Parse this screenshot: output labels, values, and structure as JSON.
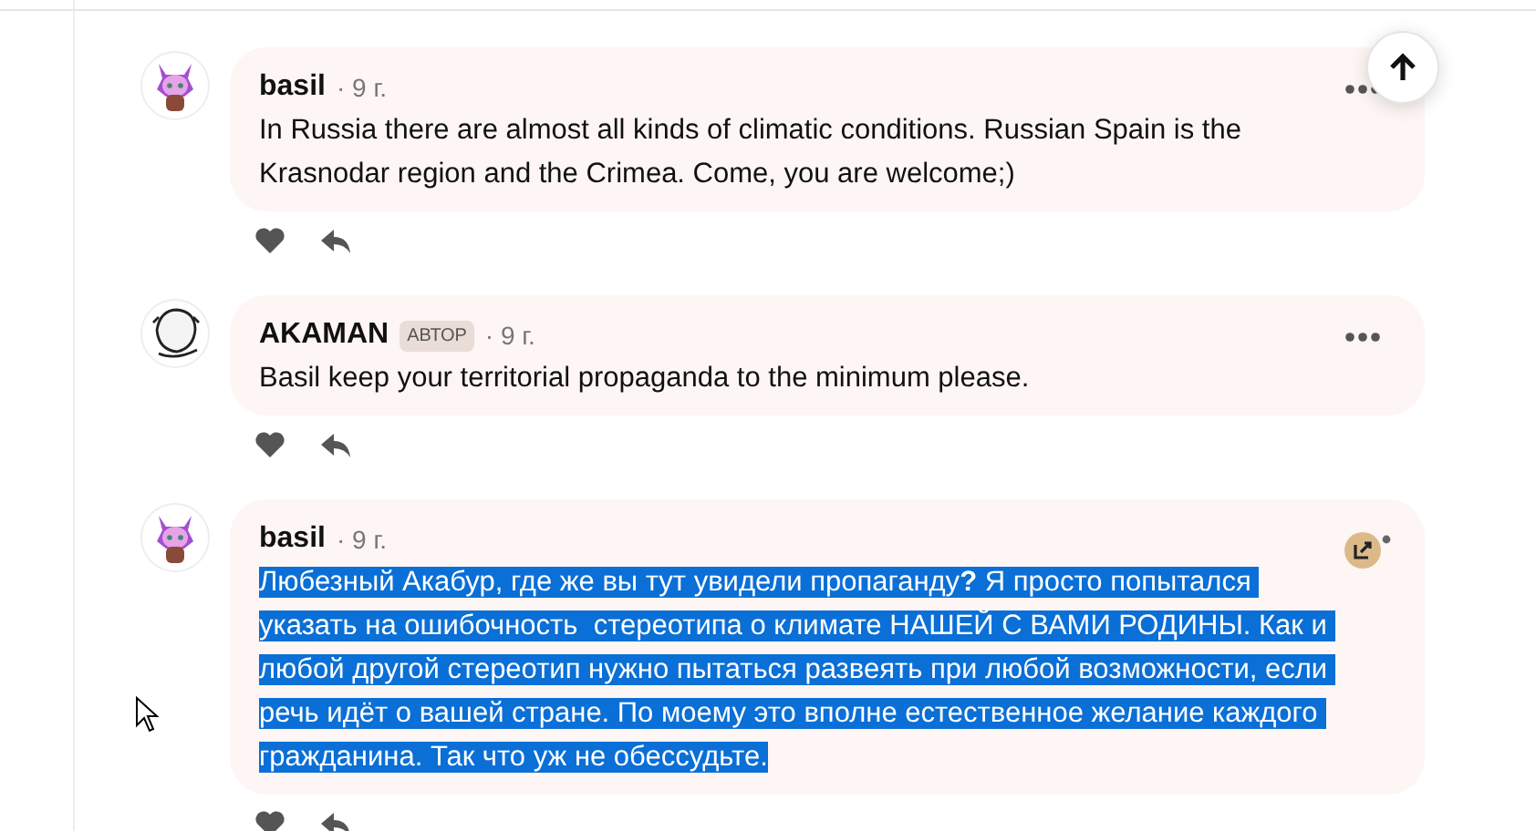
{
  "comments": [
    {
      "kind": "more",
      "author": "basil",
      "time": "· 9 г.",
      "text": "In Russia there are almost all kinds of climatic conditions. Russian Spain is the Krasnodar region and the Crimea. Come, you are welcome;)",
      "text_selected": false
    },
    {
      "kind": "more",
      "author": "AKAMAN",
      "badge": "АВТОР",
      "time": "· 9 г.",
      "text": "Basil keep your territorial propaganda to the minimum please.",
      "text_selected": false
    },
    {
      "kind": "share",
      "author": "basil",
      "time": "· 9 г.",
      "text": "Любезный Акабур, где же вы тут увидели пропаганду**?** Я просто попытался указать на ошибочность  стереотипа о климате НАШЕЙ С ВАМИ РОДИНЫ. Как и любой другой стереотип нужно пытаться развеять при любой возможности, если речь идёт о вашей стране. По моему это вполне естественное желание каждого гражданина. Так что уж не обессудьте.",
      "text_selected": true
    }
  ]
}
